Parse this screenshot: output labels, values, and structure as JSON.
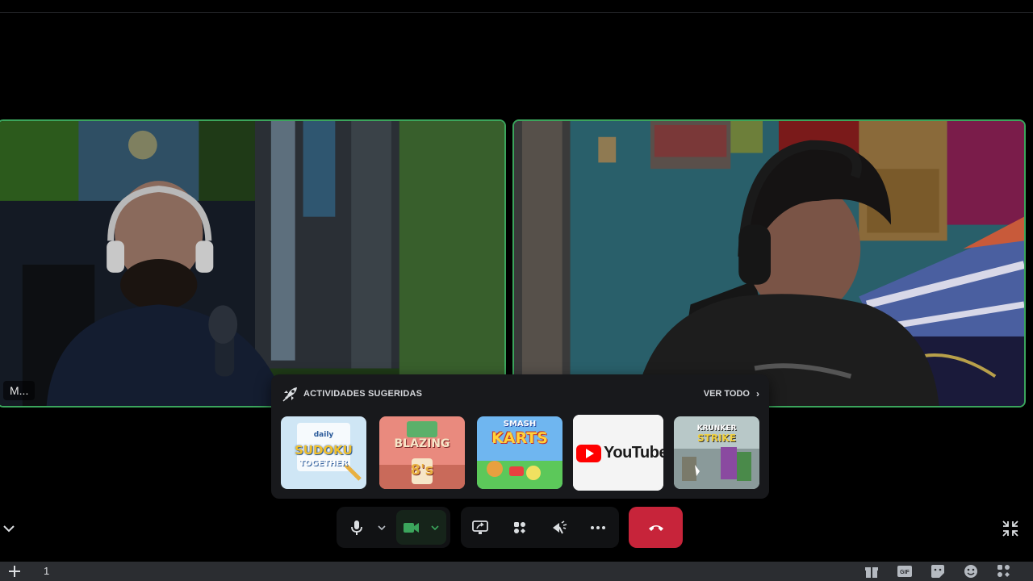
{
  "participants": [
    {
      "name_short": "M..."
    },
    {
      "name_short": ""
    }
  ],
  "activities": {
    "title": "ACTIVIDADES SUGERIDAS",
    "see_all": "VER TODO",
    "games": [
      {
        "id": "sudoku",
        "label_top": "daily",
        "label_main": "SUDOKU",
        "label_sub": "TOGETHER"
      },
      {
        "id": "blazing",
        "label_main": "BLAZING",
        "label_sub": "8's"
      },
      {
        "id": "smash",
        "label_top": "SMASH",
        "label_main": "KARTS"
      },
      {
        "id": "youtube",
        "label_main": "YouTube"
      },
      {
        "id": "krunker",
        "label_top": "KRUNKER",
        "label_main": "STRIKE"
      }
    ]
  },
  "bottom_bar": {
    "count": "1"
  },
  "colors": {
    "speaking_border": "#3ba55c",
    "hangup": "#c7243a",
    "youtube_red": "#ff0000"
  },
  "icons": [
    "rocket-icon",
    "microphone-icon",
    "chevron-down-icon",
    "camera-icon",
    "screen-share-icon",
    "activities-icon",
    "soundboard-icon",
    "more-icon",
    "hang-up-icon",
    "minimize-icon",
    "plus-icon",
    "gift-icon",
    "gif-icon",
    "sticker-icon",
    "emoji-icon",
    "apps-icon"
  ]
}
